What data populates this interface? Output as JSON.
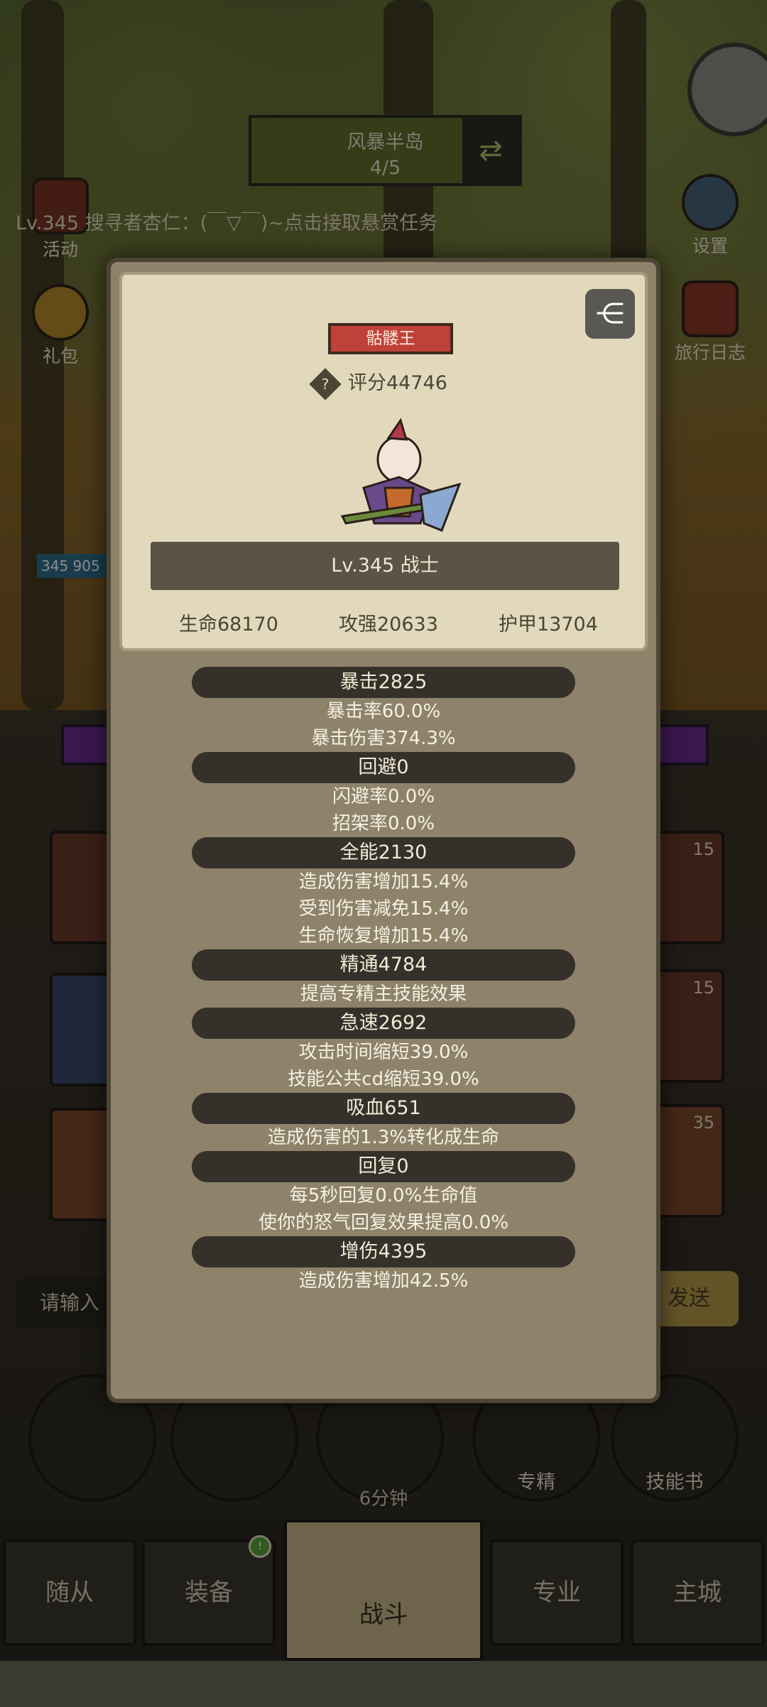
{
  "background": {
    "region": {
      "name": "风暴半岛",
      "progress": "4/5"
    },
    "left_icons": [
      {
        "label": "活动"
      },
      {
        "label": "礼包"
      }
    ],
    "right_icons": [
      {
        "label": "设置"
      },
      {
        "label": "旅行日志"
      }
    ],
    "bounty_text": "Lv.345 搜寻者杏仁：(￣▽￣)~点击接取悬赏任务",
    "hp_badge": "345 905",
    "slot_counts": [
      "15",
      "15",
      "35"
    ],
    "chat_placeholder": "请输入",
    "send_label": "发送",
    "round_buttons": [
      {
        "label": ""
      },
      {
        "label": ""
      },
      {
        "label": ""
      },
      {
        "label": "专精"
      },
      {
        "label": "技能书"
      }
    ],
    "timer": "6分钟",
    "nav": [
      "随从",
      "装备",
      "战斗",
      "专业",
      "主城"
    ],
    "notify_badge": "!"
  },
  "modal": {
    "boss_tag": "骷髅王",
    "score": "评分44746",
    "level_class": "Lv.345 战士",
    "core_stats": {
      "hp": "生命68170",
      "atk": "攻强20633",
      "armor": "护甲13704"
    },
    "stats": [
      {
        "header": "暴击2825",
        "lines": [
          "暴击率60.0%",
          "暴击伤害374.3%"
        ]
      },
      {
        "header": "回避0",
        "lines": [
          "闪避率0.0%",
          "招架率0.0%"
        ]
      },
      {
        "header": "全能2130",
        "lines": [
          "造成伤害增加15.4%",
          "受到伤害减免15.4%",
          "生命恢复增加15.4%"
        ]
      },
      {
        "header": "精通4784",
        "lines": [
          "提高专精主技能效果"
        ]
      },
      {
        "header": "急速2692",
        "lines": [
          "攻击时间缩短39.0%",
          "技能公共cd缩短39.0%"
        ]
      },
      {
        "header": "吸血651",
        "lines": [
          "造成伤害的1.3%转化成生命"
        ]
      },
      {
        "header": "回复0",
        "lines": [
          "每5秒回复0.0%生命值",
          "使你的怒气回复效果提高0.0%"
        ]
      },
      {
        "header": "增伤4395",
        "lines": [
          "造成伤害增加42.5%"
        ]
      }
    ]
  }
}
